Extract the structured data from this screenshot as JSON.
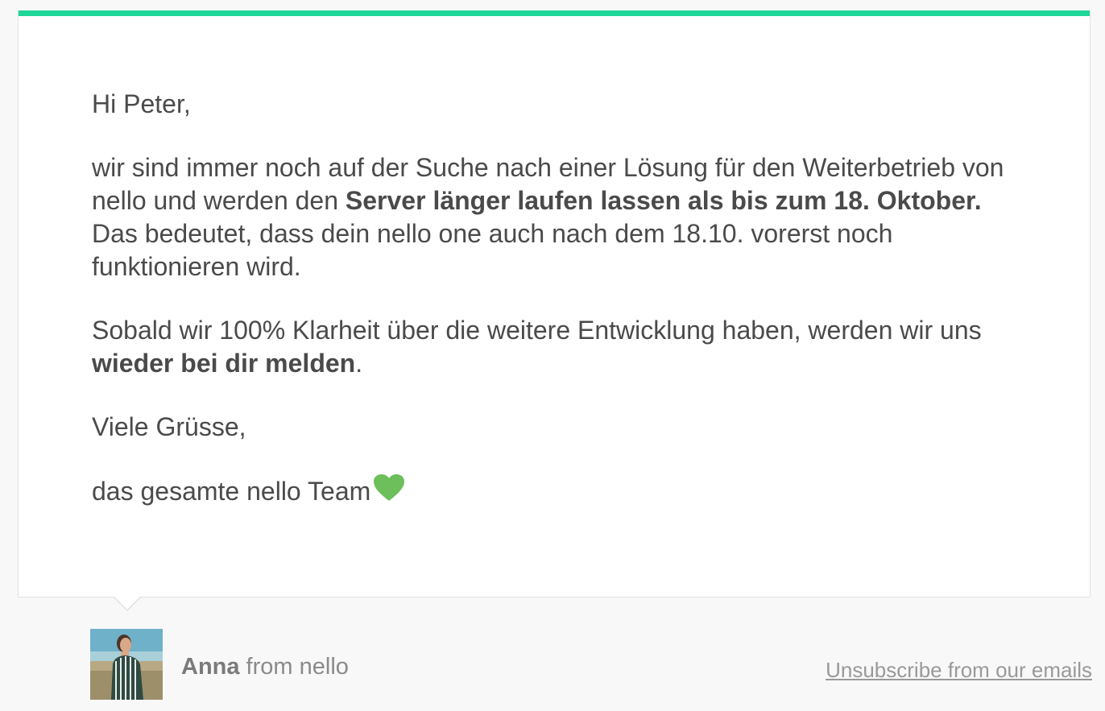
{
  "email": {
    "greeting": "Hi Peter,",
    "paragraph1": {
      "part1": "wir sind immer noch auf der Suche nach einer Lösung für den Weiterbetrieb von nello und werden den ",
      "bold1": "Server länger laufen lassen als bis zum 18. Oktober.",
      "part2": " Das bedeutet, dass dein nello one auch nach dem 18.10. vorerst noch funktionieren wird."
    },
    "paragraph2": {
      "part1": "Sobald wir 100% Klarheit über die weitere Entwicklung haben, werden wir uns ",
      "bold1": "wieder bei dir melden",
      "part2": "."
    },
    "closing": "Viele Grüsse,",
    "signature": "das gesamte nello Team",
    "signature_icon": "green-heart-icon"
  },
  "footer": {
    "sender_name": "Anna",
    "sender_suffix": " from nello",
    "unsubscribe_label": "Unsubscribe from our emails"
  },
  "colors": {
    "accent": "#1fd598",
    "heart": "#6cbf5a",
    "text": "#4a4a4a"
  }
}
